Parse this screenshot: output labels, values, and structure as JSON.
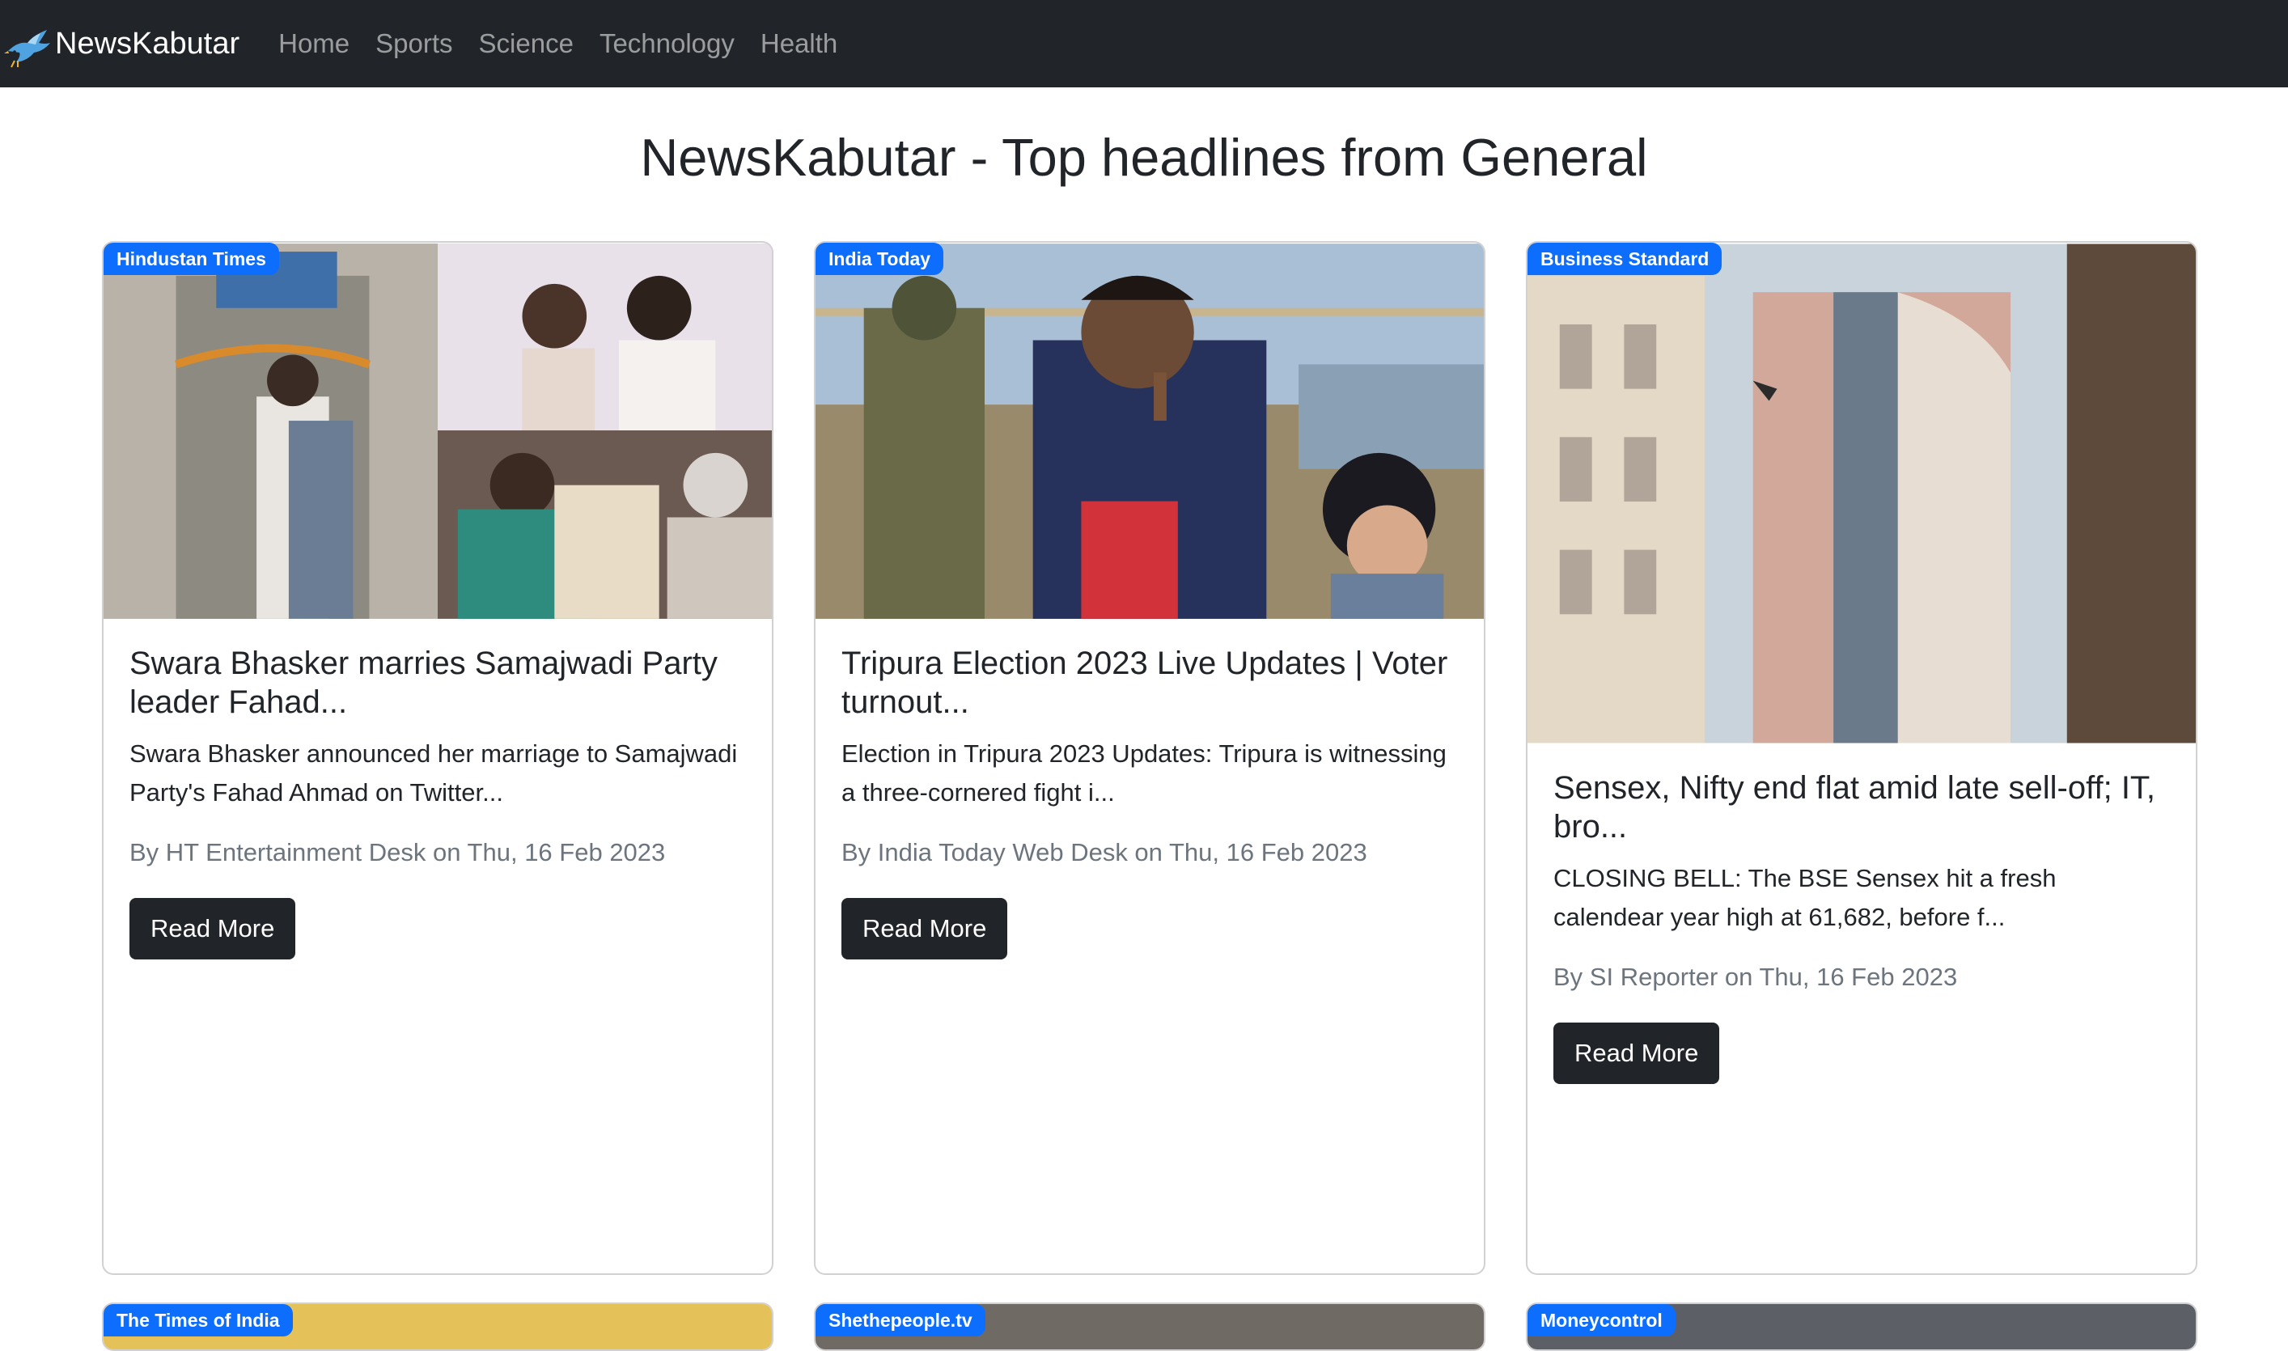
{
  "navbar": {
    "brand": "NewsKabutar",
    "links": [
      "Home",
      "Sports",
      "Science",
      "Technology",
      "Health"
    ]
  },
  "page_title": "NewsKabutar - Top headlines from General",
  "cards": [
    {
      "source": "Hindustan Times",
      "title": "Swara Bhasker marries Samajwadi Party leader Fahad...",
      "description": "Swara Bhasker announced her marriage to Samajwadi Party's Fahad Ahmad on Twitter...",
      "meta": "By HT Entertainment Desk on Thu, 16 Feb 2023",
      "button": "Read More"
    },
    {
      "source": "India Today",
      "title": "Tripura Election 2023 Live Updates | Voter turnout...",
      "description": "Election in Tripura 2023 Updates: Tripura is witnessing a three-cornered fight i...",
      "meta": "By India Today Web Desk on Thu, 16 Feb 2023",
      "button": "Read More"
    },
    {
      "source": "Business Standard",
      "title": "Sensex, Nifty end flat amid late sell-off; IT, bro...",
      "description": "CLOSING BELL: The BSE Sensex hit a fresh calendear year high at 61,682, before f...",
      "meta": "By SI Reporter on Thu, 16 Feb 2023",
      "button": "Read More"
    }
  ],
  "next_row_sources": [
    "The Times of India",
    "Shethepeople.tv",
    "Moneycontrol"
  ],
  "colors": {
    "navbar": "#212529",
    "badge": "#0d6efd",
    "button": "#212529"
  }
}
